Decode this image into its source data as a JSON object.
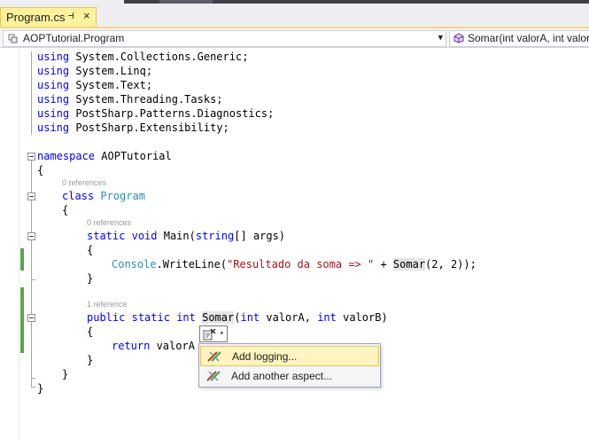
{
  "tab": {
    "title": "Program.cs",
    "pin_glyph": "⊣",
    "close_glyph": "×"
  },
  "navigation": {
    "type_selector": "AOPTutorial.Program",
    "member_selector": "Somar(int valorA, int valor",
    "dropdown_glyph": "▼"
  },
  "code": {
    "usings": [
      {
        "keyword": "using",
        "name": "System.Collections.Generic;"
      },
      {
        "keyword": "using",
        "name": "System.Linq;"
      },
      {
        "keyword": "using",
        "name": "System.Text;"
      },
      {
        "keyword": "using",
        "name": "System.Threading.Tasks;"
      },
      {
        "keyword": "using",
        "name": "PostSharp.Patterns.Diagnostics;"
      },
      {
        "keyword": "using",
        "name": "PostSharp.Extensibility;"
      }
    ],
    "namespace_keyword": "namespace",
    "namespace_name": "AOPTutorial",
    "open_brace": "{",
    "close_brace": "}",
    "class_refs": "0 references",
    "class_keyword": "class",
    "class_name": "Program",
    "main_refs": "0 references",
    "main_kw_static": "static",
    "main_kw_void": "void",
    "main_name": "Main(",
    "main_kw_string": "string",
    "main_args": "[] args)",
    "console_type": "Console",
    "console_call": ".WriteLine(",
    "console_string": "\"Resultado da soma => \"",
    "console_plus": " + ",
    "console_somar": "Somar",
    "console_args": "(2, 2));",
    "somar_refs": "1 reference",
    "somar_kw_public": "public",
    "somar_kw_static": "static",
    "somar_kw_int1": "int",
    "somar_name": "Somar",
    "somar_paren": "(",
    "somar_kw_int2": "int",
    "somar_param1": " valorA, ",
    "somar_kw_int3": "int",
    "somar_param2": " valorB)",
    "return_kw": "return",
    "return_expr": " valorA"
  },
  "smart_tag": {
    "caret": "▾"
  },
  "context_menu": {
    "items": [
      {
        "label": "Add logging..."
      },
      {
        "label": "Add another aspect..."
      }
    ]
  },
  "colors": {
    "keyword": "#0000ff",
    "type": "#2b91af",
    "string": "#a31515",
    "change_bar": "#57a64a",
    "tab_active": "#fff29d",
    "menu_highlight": "#fdf4bf"
  }
}
